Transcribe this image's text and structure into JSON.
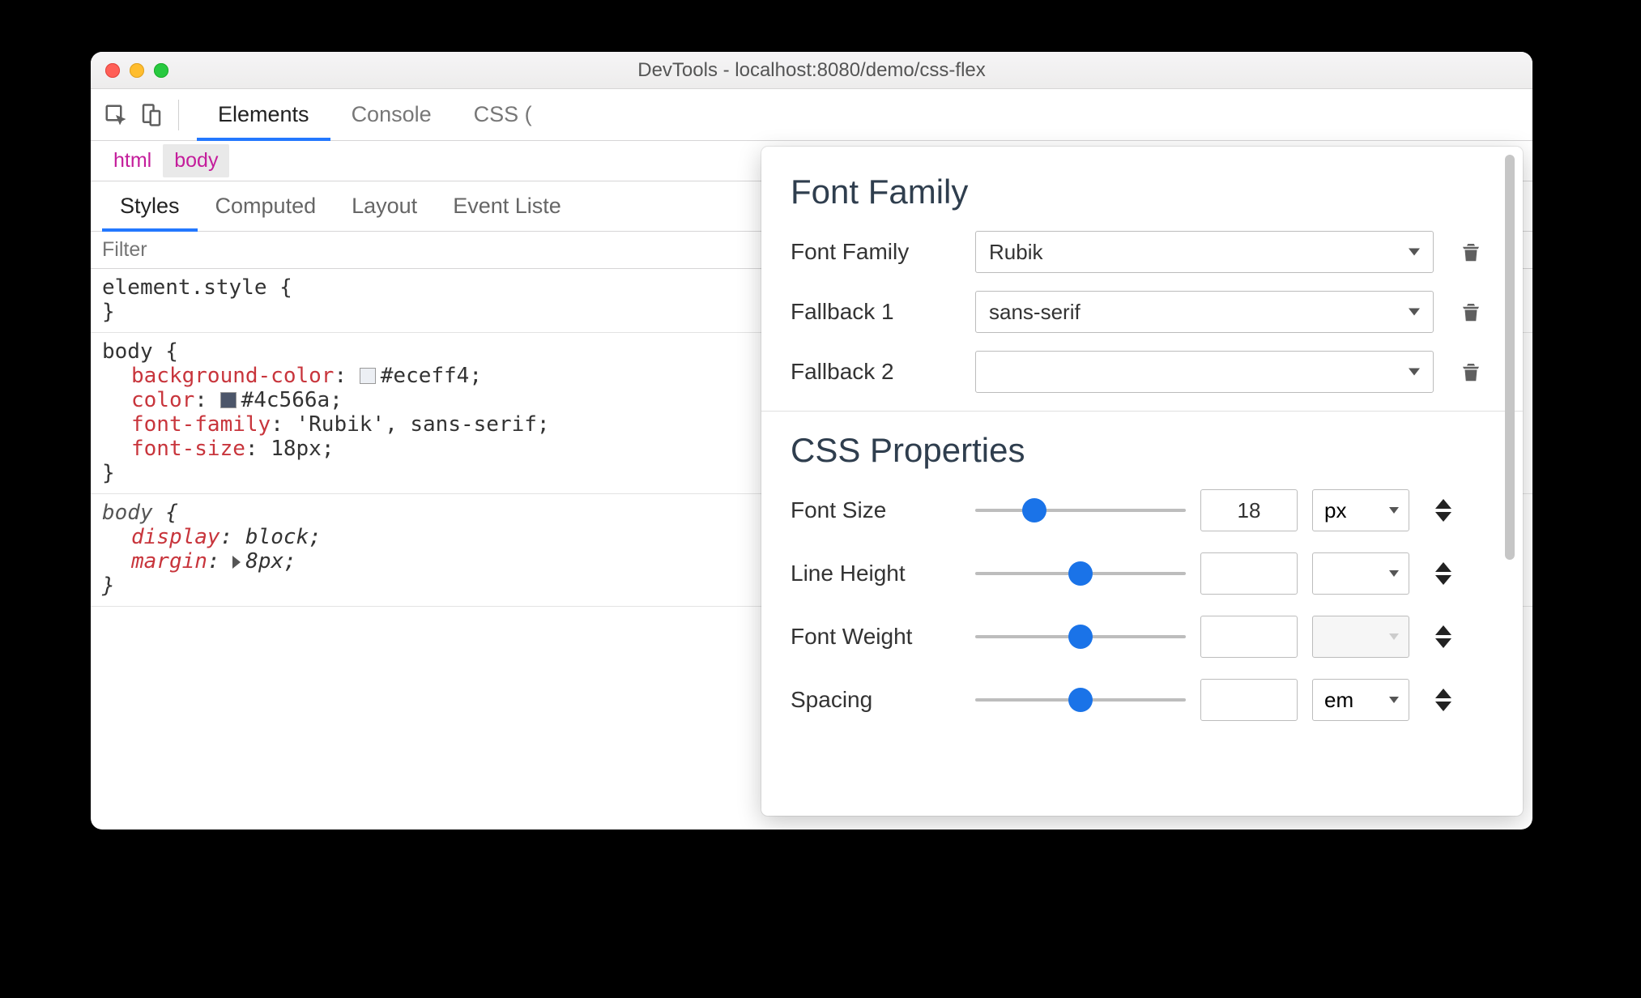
{
  "window": {
    "title": "DevTools - localhost:8080/demo/css-flex"
  },
  "tabs": {
    "elements": "Elements",
    "console": "Console",
    "css_overview_partial": "CSS ("
  },
  "breadcrumb": {
    "html": "html",
    "body": "body"
  },
  "subtabs": {
    "styles": "Styles",
    "computed": "Computed",
    "layout": "Layout",
    "event_partial": "Event Liste"
  },
  "filter_placeholder": "Filter",
  "styles": {
    "element_style": {
      "selector": "element.style"
    },
    "body1": {
      "selector": "body",
      "decls": [
        {
          "prop": "background-color",
          "value": "#eceff4",
          "swatch": "#eceff4"
        },
        {
          "prop": "color",
          "value": "#4c566a",
          "swatch": "#4c566a"
        },
        {
          "prop": "font-family",
          "value": "'Rubik', sans-serif"
        },
        {
          "prop": "font-size",
          "value": "18px"
        }
      ]
    },
    "body_ua": {
      "selector": "body",
      "decls": [
        {
          "prop": "display",
          "value": "block"
        },
        {
          "prop": "margin",
          "value": "8px",
          "expandable": true
        }
      ]
    }
  },
  "font_editor": {
    "family_title": "Font Family",
    "family_label": "Font Family",
    "family_value": "Rubik",
    "fallback1_label": "Fallback 1",
    "fallback1_value": "sans-serif",
    "fallback2_label": "Fallback 2",
    "fallback2_value": "",
    "css_title": "CSS Properties",
    "rows": {
      "font_size": {
        "label": "Font Size",
        "value": "18",
        "unit": "px",
        "thumb_pct": 28
      },
      "line_height": {
        "label": "Line Height",
        "value": "",
        "unit": "",
        "thumb_pct": 50
      },
      "font_weight": {
        "label": "Font Weight",
        "value": "",
        "unit": "",
        "thumb_pct": 50,
        "disabled": true
      },
      "spacing": {
        "label": "Spacing",
        "value": "",
        "unit": "em",
        "thumb_pct": 50
      }
    }
  }
}
